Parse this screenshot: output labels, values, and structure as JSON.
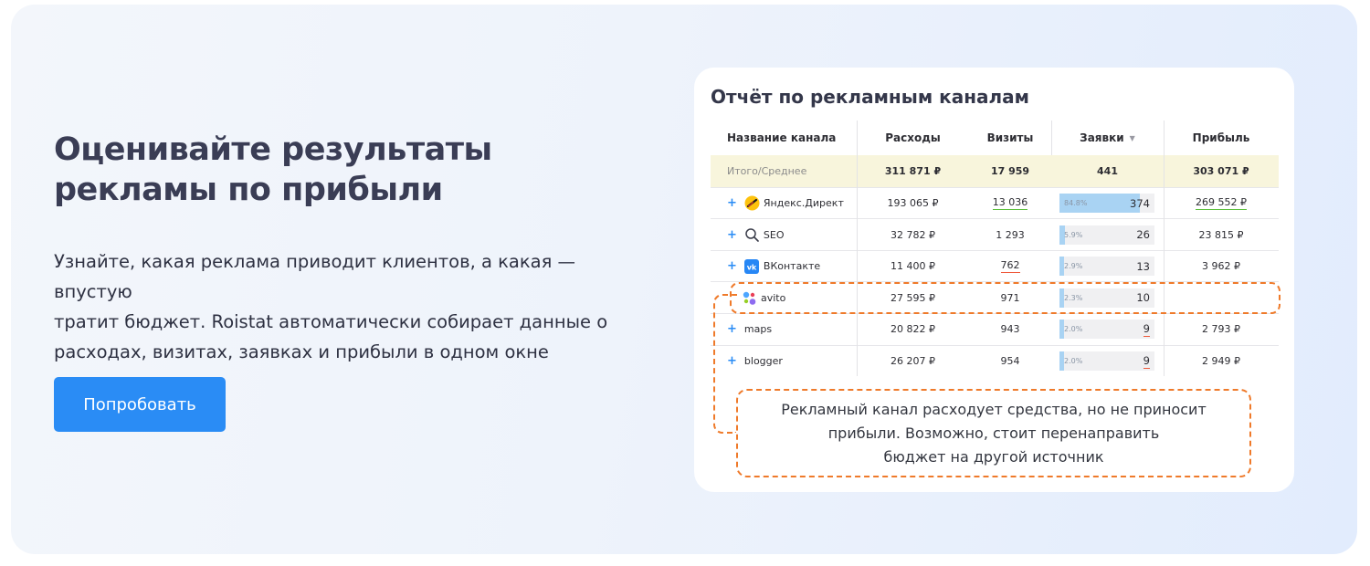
{
  "hero": {
    "headline_line1": "Оценивайте результаты",
    "headline_line2": "рекламы по прибыли",
    "subtext_line1": "Узнайте, какая реклама приводит клиентов, а какая — впустую",
    "subtext_line2": "тратит бюджет. Roistat автоматически собирает данные о",
    "subtext_line3": "расходах, визитах, заявках и прибыли в одном окне",
    "cta_label": "Попробовать"
  },
  "report": {
    "title": "Отчёт по рекламным каналам",
    "columns": {
      "name": "Название канала",
      "costs": "Расходы",
      "visits": "Визиты",
      "leads": "Заявки",
      "leads_sort": "▼",
      "profit": "Прибыль"
    },
    "total": {
      "name": "Итого/Среднее",
      "costs": "311 871 ₽",
      "visits": "17 959",
      "leads": "441",
      "profit": "303 071 ₽"
    },
    "rows": [
      {
        "plus": "+",
        "icon": "yandex-direct-icon",
        "name": "Яндекс.Директ",
        "costs": "193 065 ₽",
        "visits": "13 036",
        "leads_pct": "84.8%",
        "leads_share": 0.848,
        "leads": "374",
        "profit": "269 552 ₽"
      },
      {
        "plus": "+",
        "icon": "search-icon",
        "name": "SEO",
        "costs": "32 782 ₽",
        "visits": "1 293",
        "leads_pct": "5.9%",
        "leads_share": 0.059,
        "leads": "26",
        "profit": "23 815 ₽"
      },
      {
        "plus": "+",
        "icon": "vk-icon",
        "name": "ВКонтакте",
        "costs": "11 400 ₽",
        "visits": "762",
        "leads_pct": "2.9%",
        "leads_share": 0.029,
        "leads": "13",
        "profit": "3 962 ₽"
      },
      {
        "plus": "",
        "icon": "avito-icon",
        "name": "avito",
        "costs": "27 595 ₽",
        "visits": "971",
        "leads_pct": "2.3%",
        "leads_share": 0.023,
        "leads": "10",
        "profit": ""
      },
      {
        "plus": "+",
        "icon": "",
        "name": "maps",
        "costs": "20 822 ₽",
        "visits": "943",
        "leads_pct": "2.0%",
        "leads_share": 0.02,
        "leads": "9",
        "profit": "2 793 ₽"
      },
      {
        "plus": "+",
        "icon": "",
        "name": "blogger",
        "costs": "26 207 ₽",
        "visits": "954",
        "leads_pct": "2.0%",
        "leads_share": 0.02,
        "leads": "9",
        "profit": "2 949 ₽"
      }
    ],
    "callout_line1": "Рекламный канал расходует средства, но не приносит",
    "callout_line2": "прибыли. Возможно, стоит перенаправить",
    "callout_line3": "бюджет на другой источник"
  },
  "colors": {
    "accent": "#2a8cf5",
    "highlight_dashed": "#ef7a2a",
    "total_row_bg": "#f8f5dc",
    "bar_fill": "#a9d3f3",
    "underline_green": "#5cbf3d",
    "underline_red": "#ef5a3c"
  }
}
